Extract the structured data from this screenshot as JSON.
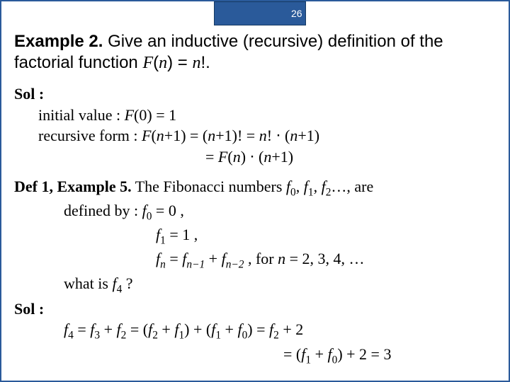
{
  "page_number": "26",
  "example": {
    "label": "Example 2.",
    "text_1": " Give an inductive (recursive) definition of the factorial function ",
    "fn": "F",
    "paren_open": "(",
    "n": "n",
    "paren_close_eq": ") = ",
    "n2": "n",
    "bang_period": "!."
  },
  "sol1": {
    "label": "Sol :",
    "init_prefix": "initial value : ",
    "init_fn": "F",
    "init_rest": "(0) = 1",
    "rec_prefix": "recursive form : ",
    "rec_fn1": "F",
    "rec_open": "(",
    "rec_n1": "n",
    "rec_mid1": "+1) = (",
    "rec_n2": "n",
    "rec_mid2": "+1)! = ",
    "rec_n3": "n",
    "rec_mid3": "! ⋅ (",
    "rec_n4": "n",
    "rec_end1": "+1)",
    "line2_eq": "= ",
    "line2_fn": "F",
    "line2_open": "(",
    "line2_n1": "n",
    "line2_mid": ") ⋅ (",
    "line2_n2": "n",
    "line2_end": "+1)"
  },
  "def": {
    "label": "Def 1, Example 5.",
    "intro": "  The Fibonacci numbers ",
    "f0": "f",
    "s0": "0",
    "c0": ", ",
    "f1": "f",
    "s1": "1",
    "c1": ", ",
    "f2": "f",
    "s2": "2",
    "dots": "…, are",
    "defined_by": "defined by :  ",
    "eq0_f": "f",
    "eq0_s": "0",
    "eq0_r": " = 0 ,",
    "eq1_f": "f",
    "eq1_s": "1",
    "eq1_r": " = 1 ,",
    "eqn_f": "f",
    "eqn_sn": "n",
    "eqn_eq": " = ",
    "eqn_f2": "f",
    "eqn_sn1": "n−1",
    "eqn_plus": " + ",
    "eqn_f3": "f",
    "eqn_sn2": "n−2",
    "eqn_for": " , for ",
    "eqn_nv": "n",
    "eqn_vals": " = 2, 3, 4, …",
    "what": "what is ",
    "what_f": "f",
    "what_s": "4",
    "what_q": " ?"
  },
  "sol2": {
    "label": "Sol :",
    "l1_f4": "f",
    "l1_s4": "4",
    "l1_eq1": " = ",
    "l1_f3": "f",
    "l1_s3": "3",
    "l1_p1": " + ",
    "l1_f2": "f",
    "l1_s2": "2",
    "l1_eq2": " = (",
    "l1_f2b": "f",
    "l1_s2b": "2",
    "l1_p2": " + ",
    "l1_f1": "f",
    "l1_s1": "1",
    "l1_cp": ") + (",
    "l1_f1b": "f",
    "l1_s1b": "1",
    "l1_p3": " + ",
    "l1_f0": "f",
    "l1_s0": "0",
    "l1_cp2": ") = ",
    "l1_f2c": "f",
    "l1_s2c": "2",
    "l1_end": " + 2",
    "l2_eq": "= (",
    "l2_f1": "f",
    "l2_s1": "1",
    "l2_p": " + ",
    "l2_f0": "f",
    "l2_s0": "0",
    "l2_end": ") + 2 = 3"
  }
}
